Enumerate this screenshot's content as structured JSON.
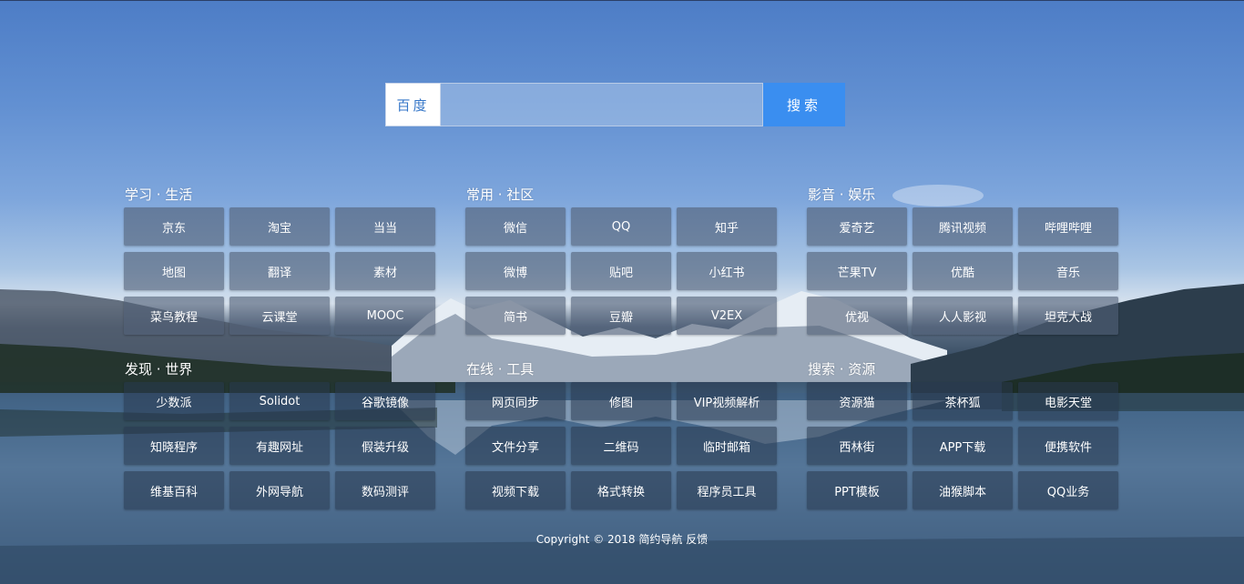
{
  "search": {
    "engine_label": "百度",
    "placeholder": "",
    "value": "",
    "button_label": "搜索"
  },
  "sections": [
    {
      "title": "学习 · 生活",
      "links": [
        "京东",
        "淘宝",
        "当当",
        "地图",
        "翻译",
        "素材",
        "菜鸟教程",
        "云课堂",
        "MOOC"
      ]
    },
    {
      "title": "常用 · 社区",
      "links": [
        "微信",
        "QQ",
        "知乎",
        "微博",
        "贴吧",
        "小红书",
        "简书",
        "豆瓣",
        "V2EX"
      ]
    },
    {
      "title": "影音 · 娱乐",
      "links": [
        "爱奇艺",
        "腾讯视频",
        "哔哩哔哩",
        "芒果TV",
        "优酷",
        "音乐",
        "优视",
        "人人影视",
        "坦克大战"
      ]
    },
    {
      "title": "发现 · 世界",
      "links": [
        "少数派",
        "Solidot",
        "谷歌镜像",
        "知晓程序",
        "有趣网址",
        "假装升级",
        "维基百科",
        "外网导航",
        "数码测评"
      ]
    },
    {
      "title": "在线 · 工具",
      "links": [
        "网页同步",
        "修图",
        "VIP视频解析",
        "文件分享",
        "二维码",
        "临时邮箱",
        "视频下载",
        "格式转换",
        "程序员工具"
      ]
    },
    {
      "title": "搜索 · 资源",
      "links": [
        "资源猫",
        "茶杯狐",
        "电影天堂",
        "西林街",
        "APP下载",
        "便携软件",
        "PPT模板",
        "油猴脚本",
        "QQ业务"
      ]
    }
  ],
  "footer": {
    "copyright": "Copyright © 2018",
    "site_link": "简约导航",
    "feedback_link": "反馈"
  },
  "colors": {
    "search_button": "#3a8ef0",
    "engine_text": "#3476c8"
  }
}
